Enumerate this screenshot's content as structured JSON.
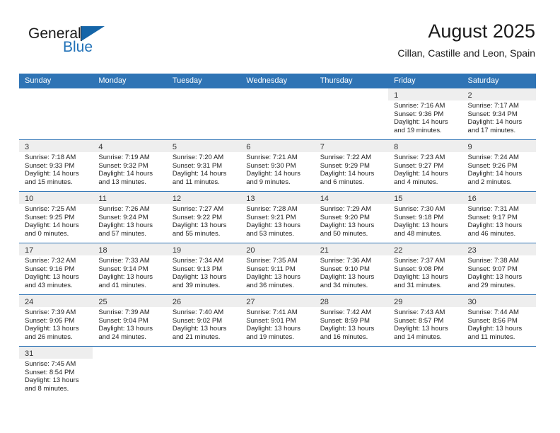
{
  "brand": {
    "word1": "General",
    "word2": "Blue",
    "triangle_color": "#1565a8",
    "blue_color": "#2272b8"
  },
  "header": {
    "title": "August 2025",
    "subtitle": "Cillan, Castille and Leon, Spain"
  },
  "theme": {
    "header_blue": "#2f74b5",
    "band_gray": "#eeeeee",
    "text": "#222222"
  },
  "weekday_headers": [
    "Sunday",
    "Monday",
    "Tuesday",
    "Wednesday",
    "Thursday",
    "Friday",
    "Saturday"
  ],
  "weeks": [
    [
      {
        "day": "",
        "lines": []
      },
      {
        "day": "",
        "lines": []
      },
      {
        "day": "",
        "lines": []
      },
      {
        "day": "",
        "lines": []
      },
      {
        "day": "",
        "lines": []
      },
      {
        "day": "1",
        "lines": [
          "Sunrise: 7:16 AM",
          "Sunset: 9:36 PM",
          "Daylight: 14 hours",
          "and 19 minutes."
        ]
      },
      {
        "day": "2",
        "lines": [
          "Sunrise: 7:17 AM",
          "Sunset: 9:34 PM",
          "Daylight: 14 hours",
          "and 17 minutes."
        ]
      }
    ],
    [
      {
        "day": "3",
        "lines": [
          "Sunrise: 7:18 AM",
          "Sunset: 9:33 PM",
          "Daylight: 14 hours",
          "and 15 minutes."
        ]
      },
      {
        "day": "4",
        "lines": [
          "Sunrise: 7:19 AM",
          "Sunset: 9:32 PM",
          "Daylight: 14 hours",
          "and 13 minutes."
        ]
      },
      {
        "day": "5",
        "lines": [
          "Sunrise: 7:20 AM",
          "Sunset: 9:31 PM",
          "Daylight: 14 hours",
          "and 11 minutes."
        ]
      },
      {
        "day": "6",
        "lines": [
          "Sunrise: 7:21 AM",
          "Sunset: 9:30 PM",
          "Daylight: 14 hours",
          "and 9 minutes."
        ]
      },
      {
        "day": "7",
        "lines": [
          "Sunrise: 7:22 AM",
          "Sunset: 9:29 PM",
          "Daylight: 14 hours",
          "and 6 minutes."
        ]
      },
      {
        "day": "8",
        "lines": [
          "Sunrise: 7:23 AM",
          "Sunset: 9:27 PM",
          "Daylight: 14 hours",
          "and 4 minutes."
        ]
      },
      {
        "day": "9",
        "lines": [
          "Sunrise: 7:24 AM",
          "Sunset: 9:26 PM",
          "Daylight: 14 hours",
          "and 2 minutes."
        ]
      }
    ],
    [
      {
        "day": "10",
        "lines": [
          "Sunrise: 7:25 AM",
          "Sunset: 9:25 PM",
          "Daylight: 14 hours",
          "and 0 minutes."
        ]
      },
      {
        "day": "11",
        "lines": [
          "Sunrise: 7:26 AM",
          "Sunset: 9:24 PM",
          "Daylight: 13 hours",
          "and 57 minutes."
        ]
      },
      {
        "day": "12",
        "lines": [
          "Sunrise: 7:27 AM",
          "Sunset: 9:22 PM",
          "Daylight: 13 hours",
          "and 55 minutes."
        ]
      },
      {
        "day": "13",
        "lines": [
          "Sunrise: 7:28 AM",
          "Sunset: 9:21 PM",
          "Daylight: 13 hours",
          "and 53 minutes."
        ]
      },
      {
        "day": "14",
        "lines": [
          "Sunrise: 7:29 AM",
          "Sunset: 9:20 PM",
          "Daylight: 13 hours",
          "and 50 minutes."
        ]
      },
      {
        "day": "15",
        "lines": [
          "Sunrise: 7:30 AM",
          "Sunset: 9:18 PM",
          "Daylight: 13 hours",
          "and 48 minutes."
        ]
      },
      {
        "day": "16",
        "lines": [
          "Sunrise: 7:31 AM",
          "Sunset: 9:17 PM",
          "Daylight: 13 hours",
          "and 46 minutes."
        ]
      }
    ],
    [
      {
        "day": "17",
        "lines": [
          "Sunrise: 7:32 AM",
          "Sunset: 9:16 PM",
          "Daylight: 13 hours",
          "and 43 minutes."
        ]
      },
      {
        "day": "18",
        "lines": [
          "Sunrise: 7:33 AM",
          "Sunset: 9:14 PM",
          "Daylight: 13 hours",
          "and 41 minutes."
        ]
      },
      {
        "day": "19",
        "lines": [
          "Sunrise: 7:34 AM",
          "Sunset: 9:13 PM",
          "Daylight: 13 hours",
          "and 39 minutes."
        ]
      },
      {
        "day": "20",
        "lines": [
          "Sunrise: 7:35 AM",
          "Sunset: 9:11 PM",
          "Daylight: 13 hours",
          "and 36 minutes."
        ]
      },
      {
        "day": "21",
        "lines": [
          "Sunrise: 7:36 AM",
          "Sunset: 9:10 PM",
          "Daylight: 13 hours",
          "and 34 minutes."
        ]
      },
      {
        "day": "22",
        "lines": [
          "Sunrise: 7:37 AM",
          "Sunset: 9:08 PM",
          "Daylight: 13 hours",
          "and 31 minutes."
        ]
      },
      {
        "day": "23",
        "lines": [
          "Sunrise: 7:38 AM",
          "Sunset: 9:07 PM",
          "Daylight: 13 hours",
          "and 29 minutes."
        ]
      }
    ],
    [
      {
        "day": "24",
        "lines": [
          "Sunrise: 7:39 AM",
          "Sunset: 9:05 PM",
          "Daylight: 13 hours",
          "and 26 minutes."
        ]
      },
      {
        "day": "25",
        "lines": [
          "Sunrise: 7:39 AM",
          "Sunset: 9:04 PM",
          "Daylight: 13 hours",
          "and 24 minutes."
        ]
      },
      {
        "day": "26",
        "lines": [
          "Sunrise: 7:40 AM",
          "Sunset: 9:02 PM",
          "Daylight: 13 hours",
          "and 21 minutes."
        ]
      },
      {
        "day": "27",
        "lines": [
          "Sunrise: 7:41 AM",
          "Sunset: 9:01 PM",
          "Daylight: 13 hours",
          "and 19 minutes."
        ]
      },
      {
        "day": "28",
        "lines": [
          "Sunrise: 7:42 AM",
          "Sunset: 8:59 PM",
          "Daylight: 13 hours",
          "and 16 minutes."
        ]
      },
      {
        "day": "29",
        "lines": [
          "Sunrise: 7:43 AM",
          "Sunset: 8:57 PM",
          "Daylight: 13 hours",
          "and 14 minutes."
        ]
      },
      {
        "day": "30",
        "lines": [
          "Sunrise: 7:44 AM",
          "Sunset: 8:56 PM",
          "Daylight: 13 hours",
          "and 11 minutes."
        ]
      }
    ],
    [
      {
        "day": "31",
        "lines": [
          "Sunrise: 7:45 AM",
          "Sunset: 8:54 PM",
          "Daylight: 13 hours",
          "and 8 minutes."
        ]
      },
      {
        "day": "",
        "lines": []
      },
      {
        "day": "",
        "lines": []
      },
      {
        "day": "",
        "lines": []
      },
      {
        "day": "",
        "lines": []
      },
      {
        "day": "",
        "lines": []
      },
      {
        "day": "",
        "lines": []
      }
    ]
  ]
}
